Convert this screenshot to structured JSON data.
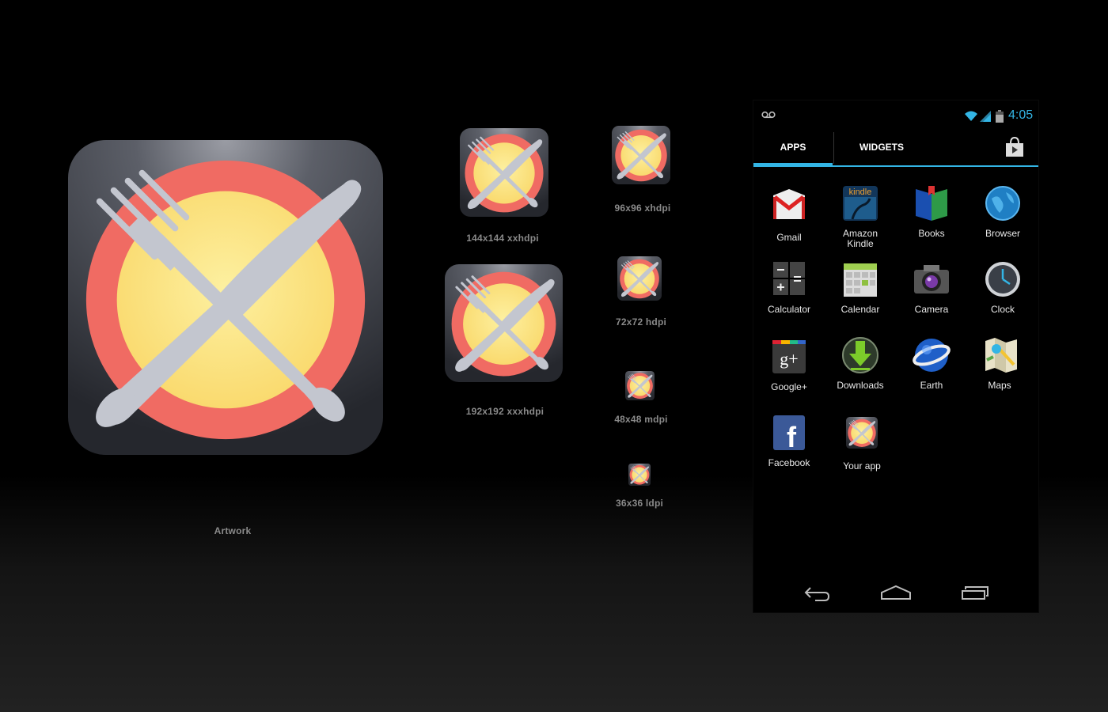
{
  "artwork": {
    "caption": "Artwork"
  },
  "sizes": [
    {
      "caption": "144x144 xxhdpi"
    },
    {
      "caption": "192x192 xxxhdpi"
    },
    {
      "caption": "96x96 xhdpi"
    },
    {
      "caption": "72x72 hdpi"
    },
    {
      "caption": "48x48 mdpi"
    },
    {
      "caption": "36x36 ldpi"
    }
  ],
  "phone": {
    "status": {
      "time": "4:05",
      "accent": "#33b5e5"
    },
    "tabs": {
      "apps": "APPS",
      "widgets": "WIDGETS"
    },
    "apps": [
      {
        "label": "Gmail",
        "icon": "gmail-icon"
      },
      {
        "label": "Amazon Kindle",
        "icon": "kindle-icon",
        "badge": "kindle"
      },
      {
        "label": "Books",
        "icon": "books-icon"
      },
      {
        "label": "Browser",
        "icon": "browser-icon"
      },
      {
        "label": "Calculator",
        "icon": "calculator-icon"
      },
      {
        "label": "Calendar",
        "icon": "calendar-icon"
      },
      {
        "label": "Camera",
        "icon": "camera-icon"
      },
      {
        "label": "Clock",
        "icon": "clock-icon"
      },
      {
        "label": "Google+",
        "icon": "google-plus-icon",
        "badge": "g+"
      },
      {
        "label": "Downloads",
        "icon": "downloads-icon"
      },
      {
        "label": "Earth",
        "icon": "earth-icon"
      },
      {
        "label": "Maps",
        "icon": "maps-icon"
      },
      {
        "label": "Facebook",
        "icon": "facebook-icon",
        "badge": "f"
      },
      {
        "label": "Your app",
        "icon": "your-app-icon"
      }
    ]
  },
  "colors": {
    "plate_outer": "#f06b63",
    "plate_inner": "#fbe27a",
    "cutlery": "#c3c6cf",
    "tile_dark": "#2f323a"
  }
}
